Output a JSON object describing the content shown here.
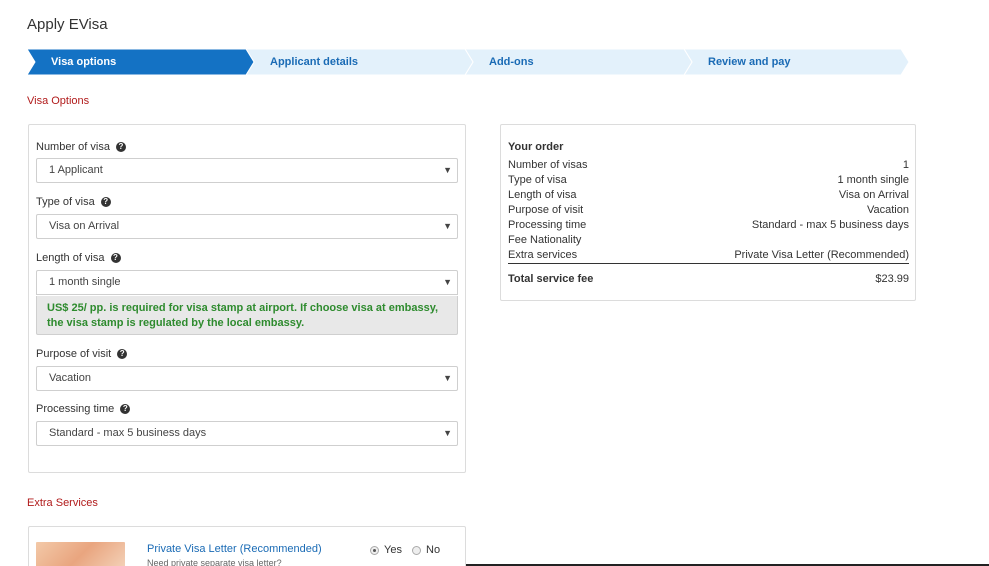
{
  "page": {
    "title": "Apply EVisa"
  },
  "stepper": {
    "steps": [
      {
        "label": "Visa options",
        "active": true
      },
      {
        "label": "Applicant details",
        "active": false
      },
      {
        "label": "Add-ons",
        "active": false
      },
      {
        "label": "Review and pay",
        "active": false
      }
    ],
    "active_color": "#1472c4",
    "inactive_color": "#e3f1fb"
  },
  "visa_options": {
    "section_title": "Visa Options",
    "fields": [
      {
        "label": "Number of visa",
        "value": "1 Applicant"
      },
      {
        "label": "Type of visa",
        "value": "Visa on Arrival"
      },
      {
        "label": "Length of visa",
        "value": "1 month single"
      },
      {
        "label": "Purpose of visit",
        "value": "Vacation"
      },
      {
        "label": "Processing time",
        "value": "Standard - max 5 business days"
      }
    ],
    "notice": "US$ 25/ pp. is required for visa stamp at airport. If choose visa at embassy, the visa stamp is regulated by the local embassy.",
    "help_icon": "question-circle-icon",
    "dropdown_icon": "caret-down-icon"
  },
  "order": {
    "title": "Your order",
    "rows": [
      {
        "key": "Number of visas",
        "value": "1"
      },
      {
        "key": "Type of visa",
        "value": "1 month single"
      },
      {
        "key": "Length of visa",
        "value": "Visa on Arrival"
      },
      {
        "key": "Purpose of visit",
        "value": "Vacation"
      },
      {
        "key": "Processing time",
        "value": "Standard - max 5 business days"
      },
      {
        "key": "Fee Nationality",
        "value": ""
      },
      {
        "key": "Extra services",
        "value": "Private Visa Letter (Recommended)"
      }
    ],
    "total_label": "Total service fee",
    "total_value": "$23.99"
  },
  "extra_services": {
    "section_title": "Extra Services",
    "items": [
      {
        "name": "Private Visa Letter (Recommended)",
        "description": "Need private separate visa letter?",
        "yes_label": "Yes",
        "no_label": "No",
        "selected": "Yes"
      }
    ]
  },
  "colors": {
    "section_title": "#b11b1b",
    "link": "#1a6bb5",
    "notice_text": "#2e8b2e"
  }
}
